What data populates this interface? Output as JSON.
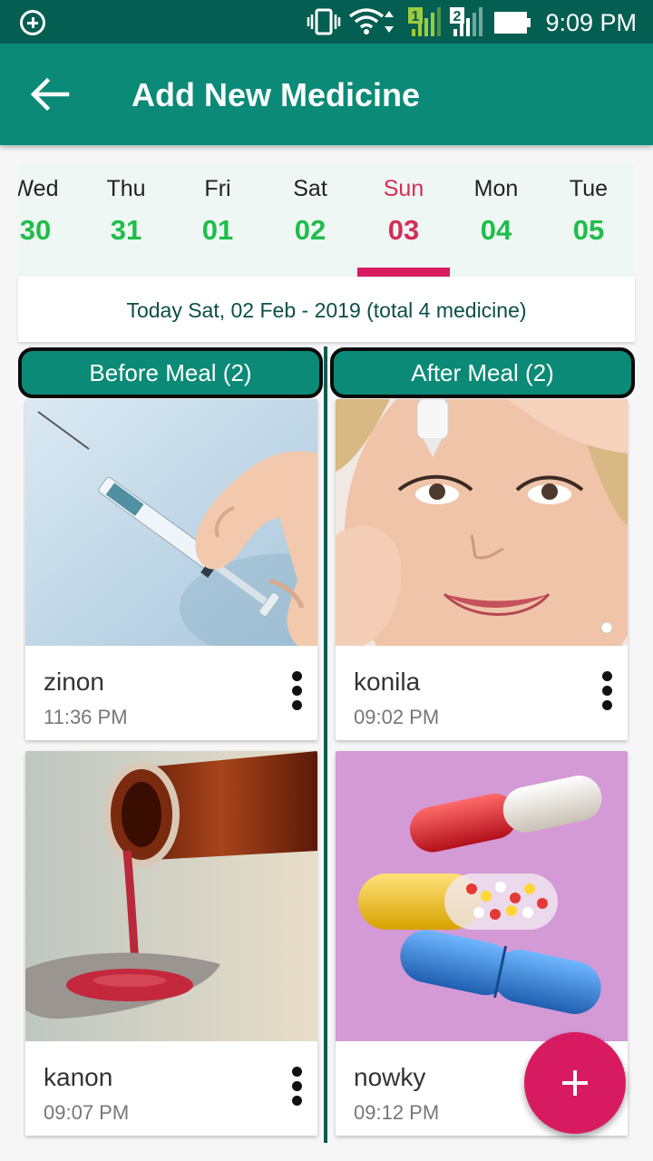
{
  "status_bar": {
    "time": "9:09 PM",
    "sim1": "1",
    "sim2": "2"
  },
  "app_bar": {
    "title": "Add New Medicine"
  },
  "days": [
    {
      "name": "Wed",
      "date": "30"
    },
    {
      "name": "Thu",
      "date": "31"
    },
    {
      "name": "Fri",
      "date": "01"
    },
    {
      "name": "Sat",
      "date": "02"
    },
    {
      "name": "Sun",
      "date": "03",
      "selected": true
    },
    {
      "name": "Mon",
      "date": "04"
    },
    {
      "name": "Tue",
      "date": "05"
    }
  ],
  "summary": "Today Sat, 02 Feb - 2019 (total 4 medicine)",
  "before_meal": {
    "header": "Before Meal (2)",
    "items": [
      {
        "name": "zinon",
        "time": "11:36 PM",
        "image": "syringe"
      },
      {
        "name": "kanon",
        "time": "09:07 PM",
        "image": "syrup"
      }
    ]
  },
  "after_meal": {
    "header": "After Meal (2)",
    "items": [
      {
        "name": "konila",
        "time": "09:02 PM",
        "image": "eye-drops"
      },
      {
        "name": "nowky",
        "time": "09:12 PM",
        "image": "capsules"
      }
    ]
  },
  "colors": {
    "primary": "#0b8a77",
    "primary_dark": "#055e52",
    "accent": "#d81b60",
    "date_green": "#1fbd4a"
  }
}
